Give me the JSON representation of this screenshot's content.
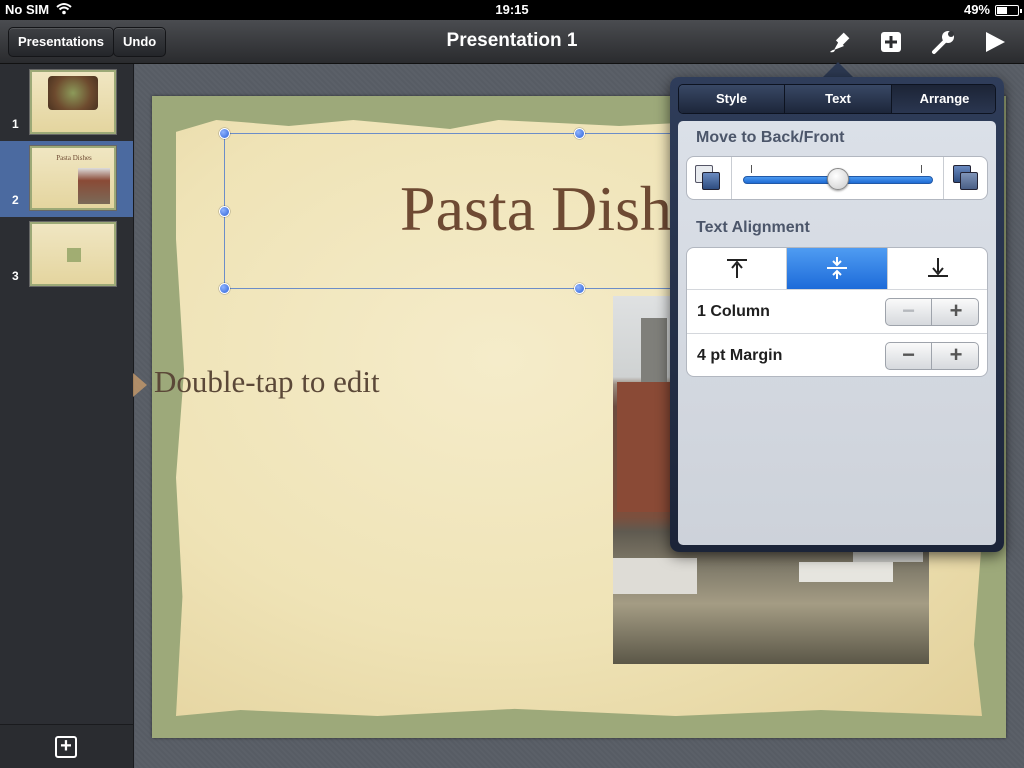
{
  "status": {
    "carrier": "No SIM",
    "time": "19:15",
    "battery": "49%",
    "battery_level": 0.49
  },
  "toolbar": {
    "presentations_label": "Presentations",
    "undo_label": "Undo",
    "title": "Presentation 1",
    "icons": [
      "paintbrush-icon",
      "insert-icon",
      "wrench-icon",
      "play-icon"
    ]
  },
  "slides": [
    {
      "number": "1",
      "title": ""
    },
    {
      "number": "2",
      "title": "Pasta Dishes"
    },
    {
      "number": "3",
      "title": ""
    }
  ],
  "current_slide": {
    "title": "Pasta Dish",
    "body_placeholder": "Double-tap to edit"
  },
  "inspector": {
    "tabs": [
      "Style",
      "Text",
      "Arrange"
    ],
    "active_tab": "Arrange",
    "move_label": "Move to Back/Front",
    "alignment_label": "Text Alignment",
    "alignment_options": [
      "top-align-icon",
      "middle-align-icon",
      "bottom-align-icon"
    ],
    "alignment_selected": "middle",
    "columns_label": "1 Column",
    "margin_label": "4 pt Margin"
  }
}
